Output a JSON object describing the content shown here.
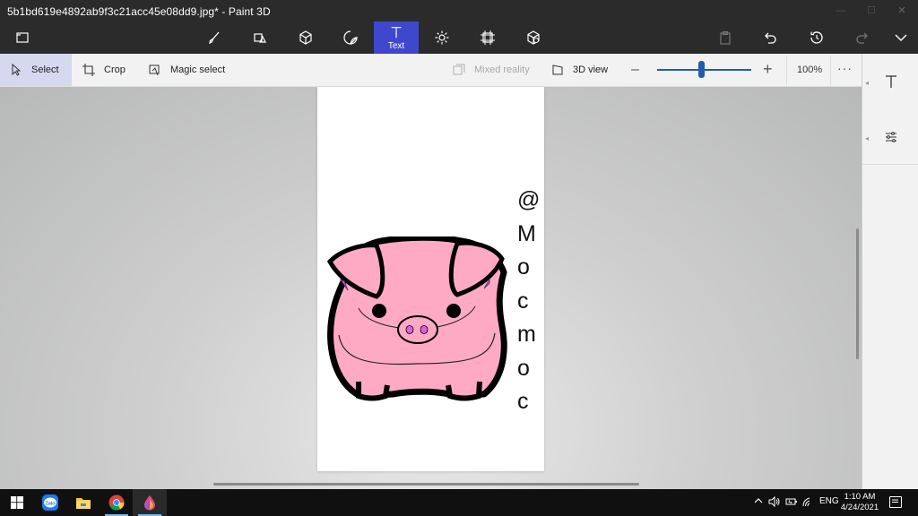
{
  "window": {
    "title": "5b1bd619e4892ab9f3c21acc45e08dd9.jpg* - Paint 3D"
  },
  "toolbar": {
    "menu_icon": "folder-open-icon",
    "tools": [
      {
        "name": "brushes",
        "icon": "brush-icon"
      },
      {
        "name": "2d-shapes",
        "icon": "2d-shapes-icon"
      },
      {
        "name": "3d-shapes",
        "icon": "3d-cube-icon"
      },
      {
        "name": "stickers",
        "icon": "sticker-icon"
      },
      {
        "name": "text",
        "icon": "text-icon",
        "label": "Text",
        "active": true
      },
      {
        "name": "effects",
        "icon": "sun-icon"
      },
      {
        "name": "canvas",
        "icon": "canvas-crop-icon"
      },
      {
        "name": "3d-library",
        "icon": "box-icon"
      }
    ],
    "actions": [
      "paste-icon",
      "undo-icon",
      "history-icon",
      "redo-icon",
      "chevron-down-icon"
    ]
  },
  "subbar": {
    "select_label": "Select",
    "crop_label": "Crop",
    "magic_select_label": "Magic select",
    "mixed_reality_label": "Mixed reality",
    "view3d_label": "3D view",
    "zoom_value": "100%",
    "zoom_level": 0.47,
    "more_label": "···"
  },
  "sidepanel": {
    "items": [
      "text-tool-icon",
      "settings-sliders-icon"
    ]
  },
  "canvas": {
    "vertical_text": [
      "@",
      "M",
      "o",
      "c",
      "m",
      "o",
      "c"
    ],
    "pig_color": "#ffaac4"
  },
  "taskbar": {
    "apps": [
      "windows-start-icon",
      "zalo-icon",
      "file-explorer-icon",
      "chrome-icon",
      "paint3d-icon"
    ],
    "language": "ENG",
    "time": "1:10 AM",
    "date": "4/24/2021"
  },
  "colors": {
    "accent": "#3f48cc",
    "slider": "#1e5fa8",
    "titlebar": "#2b2b2b"
  }
}
